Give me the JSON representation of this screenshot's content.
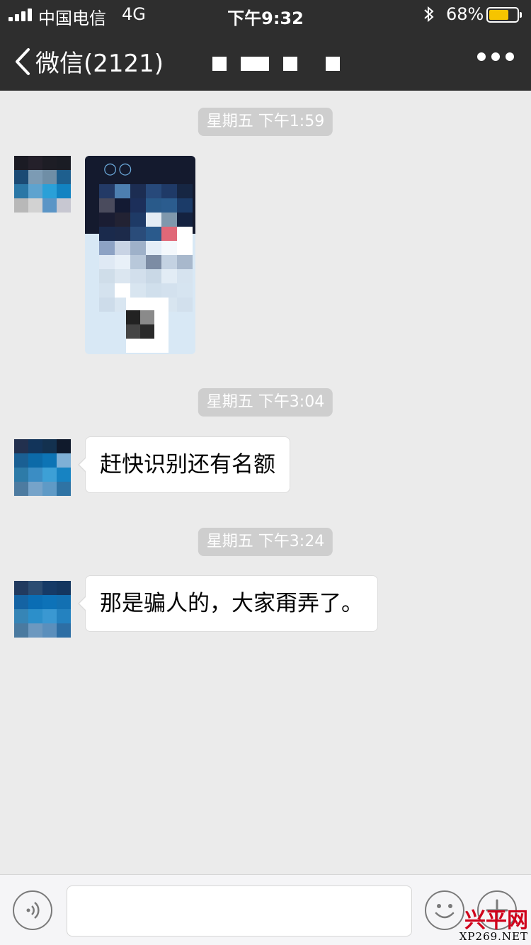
{
  "status_bar": {
    "carrier": "中国电信",
    "network": "4G",
    "time": "下午9:32",
    "battery_percent": "68%",
    "battery_level": 0.68,
    "icons": [
      "signal-icon",
      "bluetooth-icon",
      "battery-icon"
    ]
  },
  "nav": {
    "back_label": "微信(2121)",
    "title": "",
    "icons": [
      "chevron-left-icon",
      "more-icon"
    ]
  },
  "messages": [
    {
      "timestamp": "星期五 下午1:59",
      "type": "image"
    },
    {
      "timestamp": "星期五 下午3:04",
      "type": "text",
      "text": "赶快识别还有名额"
    },
    {
      "timestamp": "星期五 下午3:24",
      "type": "text",
      "text": "那是骗人的，大家甭弄了。"
    }
  ],
  "input_bar": {
    "value": "",
    "placeholder": "",
    "icons": [
      "voice-icon",
      "emoji-icon",
      "plus-icon"
    ]
  },
  "watermark": {
    "logo_text": "兴平网",
    "site": "XP269.NET"
  },
  "colors": {
    "nav_background": "#2e2e2e",
    "chat_background": "#ebebeb",
    "bubble": "#ffffff",
    "battery_fill": "#f6c400",
    "watermark": "#d0021b"
  }
}
